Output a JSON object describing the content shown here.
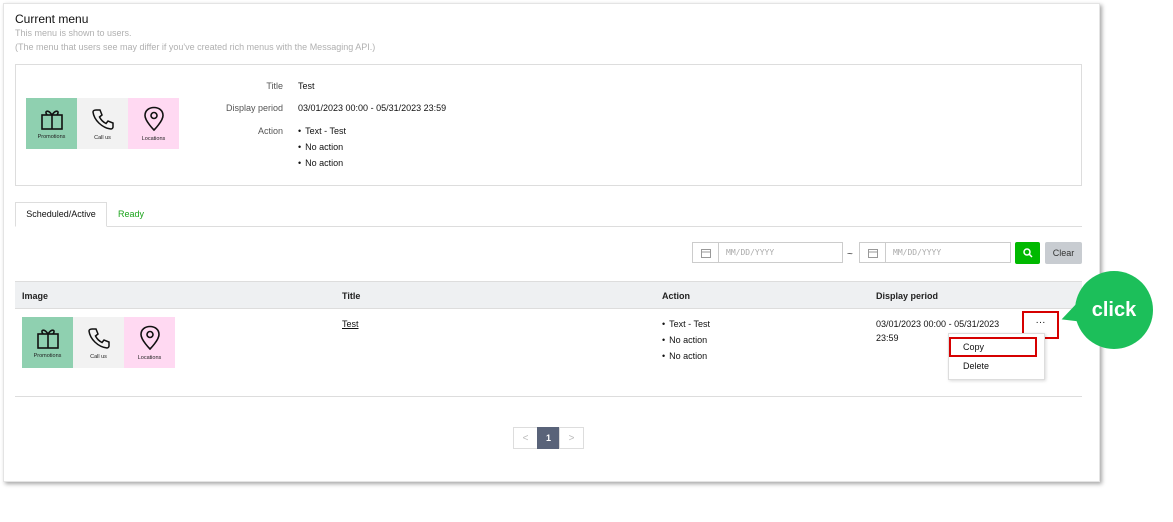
{
  "header": {
    "title": "Current menu",
    "subtitle_1": "This menu is shown to users.",
    "subtitle_2": "(The menu that users see may differ if you've created rich menus with the Messaging API.)"
  },
  "current_menu": {
    "tiles": [
      {
        "label": "Promotions",
        "icon": "gift-icon",
        "color": "#8fd0b0"
      },
      {
        "label": "Call us",
        "icon": "phone-icon",
        "color": "#f2f2f2"
      },
      {
        "label": "Locations",
        "icon": "location-pin-icon",
        "color": "#ffd9f2"
      }
    ],
    "title_label": "Title",
    "title_value": "Test",
    "period_label": "Display period",
    "period_value": "03/01/2023 00:00 - 05/31/2023 23:59",
    "action_label": "Action",
    "actions": [
      "Text - Test",
      "No action",
      "No action"
    ]
  },
  "tabs": {
    "active": "Scheduled/Active",
    "other": "Ready"
  },
  "filter": {
    "start_placeholder": "MM/DD/YYYY",
    "separator": "~",
    "end_placeholder": "MM/DD/YYYY",
    "clear_label": "Clear"
  },
  "table": {
    "columns": [
      "Image",
      "Title",
      "Action",
      "Display period"
    ],
    "rows": [
      {
        "tiles": [
          {
            "label": "Promotions",
            "icon": "gift-icon",
            "color": "#8fd0b0"
          },
          {
            "label": "Call us",
            "icon": "phone-icon",
            "color": "#f2f2f2"
          },
          {
            "label": "Locations",
            "icon": "location-pin-icon",
            "color": "#ffd9f2"
          }
        ],
        "title": "Test",
        "actions": [
          "Text - Test",
          "No action",
          "No action"
        ],
        "period_line_1": "03/01/2023 00:00 - 05/31/2023",
        "period_line_2": "23:59",
        "more_label": "···"
      }
    ]
  },
  "row_menu": {
    "items": [
      "Copy",
      "Delete"
    ]
  },
  "pagination": {
    "prev": "<",
    "current": "1",
    "next": ">"
  },
  "callout": {
    "text": "click",
    "color": "#1cbf5a",
    "highlight_color": "#d60000"
  }
}
